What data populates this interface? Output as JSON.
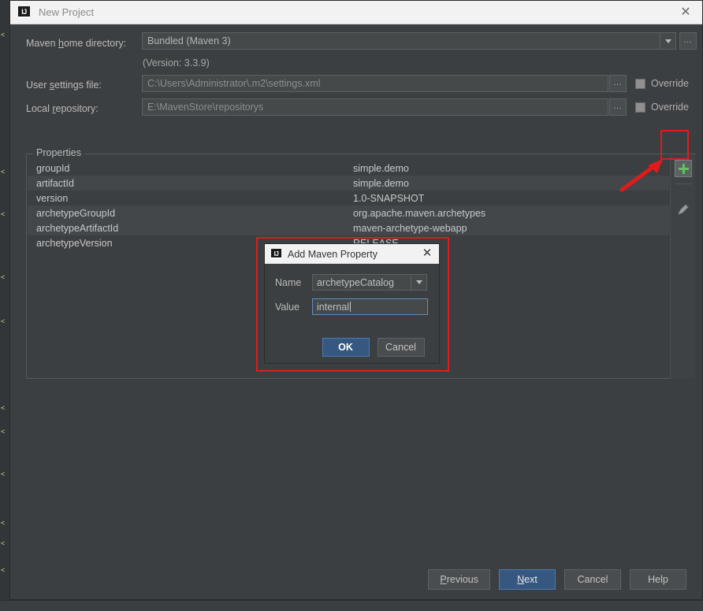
{
  "window": {
    "title": "New Project",
    "app_icon": "IJ",
    "close_icon": "✕"
  },
  "form": {
    "maven_home": {
      "label_pre": "Maven ",
      "label_accel": "h",
      "label_post": "ome directory:",
      "value": "Bundled (Maven 3)",
      "dropdown_icon": "chevron-down-icon",
      "browse_label": "…"
    },
    "version_note": "(Version: 3.3.9)",
    "user_settings": {
      "label_pre": "User ",
      "label_accel": "s",
      "label_post": "ettings file:",
      "value": "C:\\Users\\Administrator\\.m2\\settings.xml",
      "browse_label": "…",
      "override_label": "Override",
      "override_checked": false
    },
    "local_repository": {
      "label_pre": "Local ",
      "label_accel": "r",
      "label_post": "epository:",
      "value": "E:\\MavenStore\\repositorys",
      "browse_label": "…",
      "override_label": "Override",
      "override_checked": false
    }
  },
  "properties": {
    "legend": "Properties",
    "rows": [
      {
        "key": "groupId",
        "value": "simple.demo"
      },
      {
        "key": "artifactId",
        "value": "simple.demo"
      },
      {
        "key": "version",
        "value": "1.0-SNAPSHOT"
      },
      {
        "key": "archetypeGroupId",
        "value": "org.apache.maven.archetypes"
      },
      {
        "key": "archetypeArtifactId",
        "value": "maven-archetype-webapp"
      },
      {
        "key": "archetypeVersion",
        "value": "RELEASE"
      }
    ],
    "toolbar": {
      "add_icon": "plus-icon",
      "edit_icon": "pencil-icon"
    }
  },
  "modal": {
    "title": "Add Maven Property",
    "app_icon": "IJ",
    "close_icon": "✕",
    "name_label": "Name",
    "name_value": "archetypeCatalog",
    "name_dropdown_icon": "chevron-down-icon",
    "value_label": "Value",
    "value_value": "internal",
    "ok_label": "OK",
    "cancel_label": "Cancel"
  },
  "footer": {
    "previous_pre": "",
    "previous_accel": "P",
    "previous_post": "revious",
    "next_pre": "",
    "next_accel": "N",
    "next_post": "ext",
    "cancel_label": "Cancel",
    "help_label": "Help"
  },
  "annotations": {
    "highlight_color": "#e01b1b",
    "arrow_name": "red-arrow-pointing-to-add-button"
  },
  "colors": {
    "dialog_bg": "#3c3f41",
    "field_bg": "#45494a",
    "row_alt_bg": "#43474a",
    "accent_blue": "#365880",
    "plus_green": "#5fc15f",
    "annotation_red": "#e01b1b"
  }
}
